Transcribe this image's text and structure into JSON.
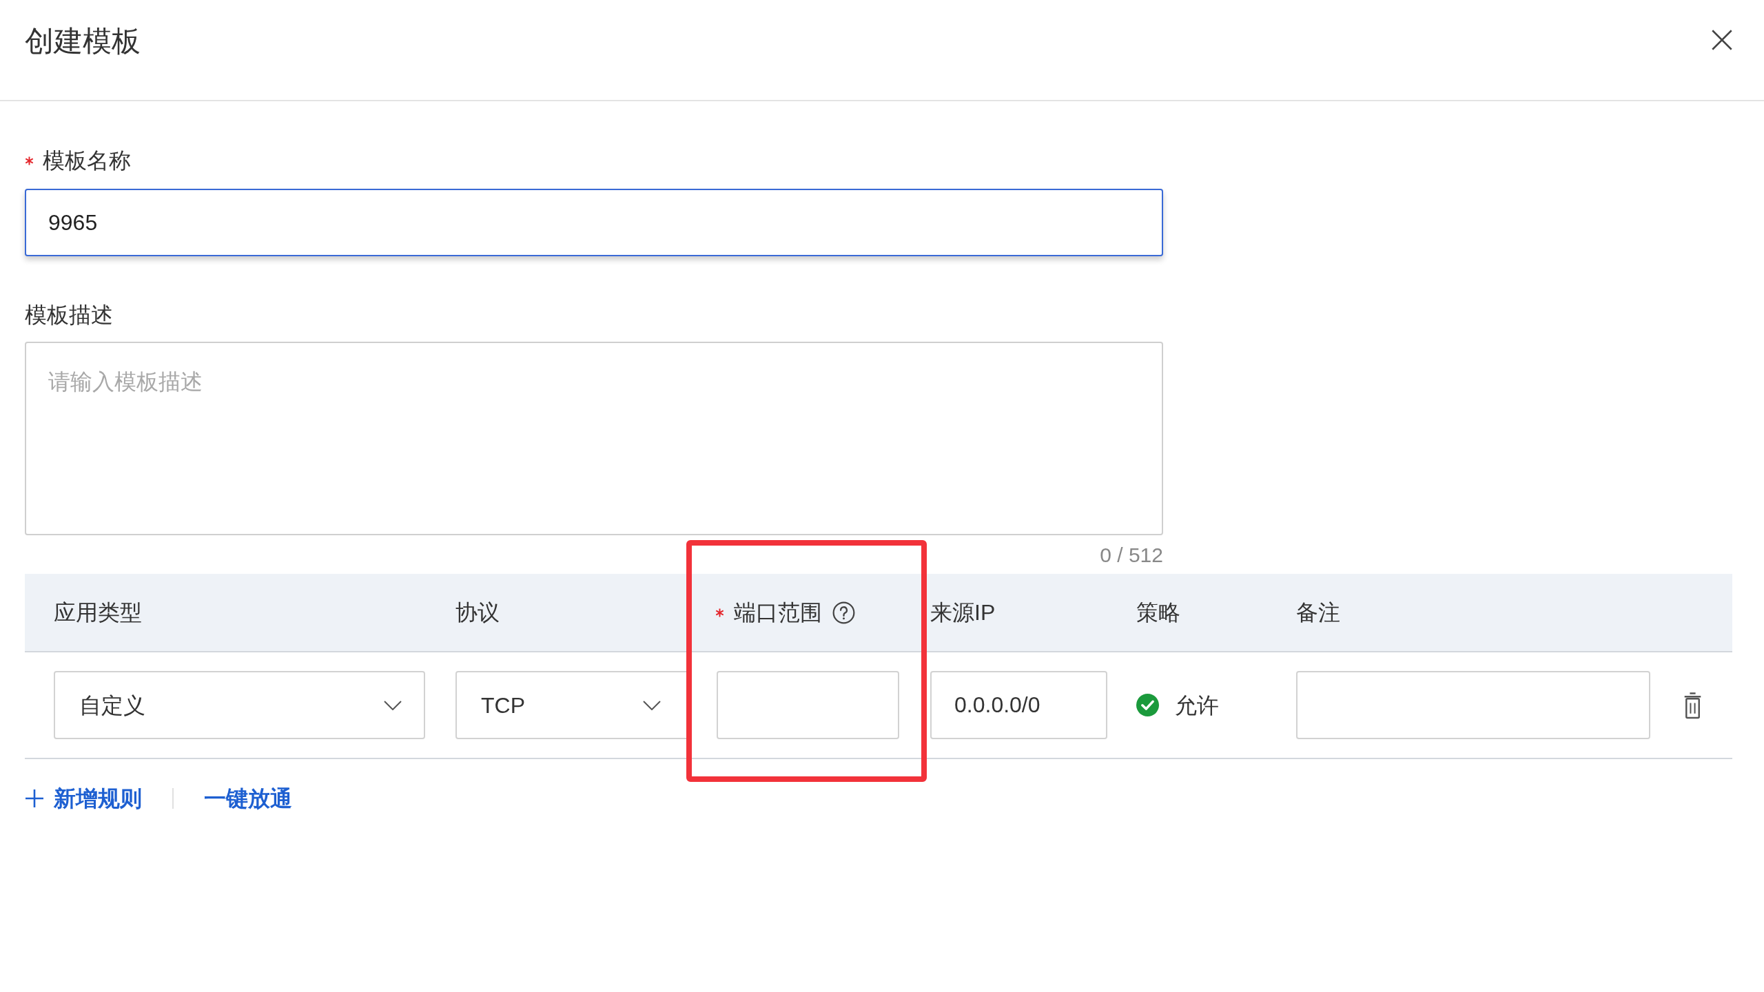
{
  "dialog": {
    "title": "创建模板"
  },
  "fields": [
    {
      "kind": "input",
      "label": "模板名称",
      "required": true,
      "focused": true,
      "value": "9965"
    },
    {
      "kind": "textarea",
      "label": "模板描述",
      "required": false,
      "focused": false,
      "placeholder": "请输入模板描述",
      "counter": "0 / 512"
    }
  ],
  "table": {
    "columns": [
      {
        "label": "应用类型",
        "required": false,
        "help": false,
        "highlighted": false
      },
      {
        "label": "协议",
        "required": false,
        "help": false,
        "highlighted": false
      },
      {
        "label": "端口范围",
        "required": true,
        "help": true,
        "highlighted": true
      },
      {
        "label": "来源IP",
        "required": false,
        "help": false,
        "highlighted": false
      },
      {
        "label": "策略",
        "required": false,
        "help": false,
        "highlighted": false
      },
      {
        "label": "备注",
        "required": false,
        "help": false,
        "highlighted": false
      }
    ],
    "rows": [
      {
        "app_type": "自定义",
        "protocol": "TCP",
        "source_ip": "0.0.0.0/0",
        "policy": "允许",
        "allowed": true
      }
    ]
  },
  "actions": [
    {
      "kind": "add",
      "label": "新增规则"
    },
    {
      "kind": "plain",
      "label": "一键放通"
    }
  ]
}
